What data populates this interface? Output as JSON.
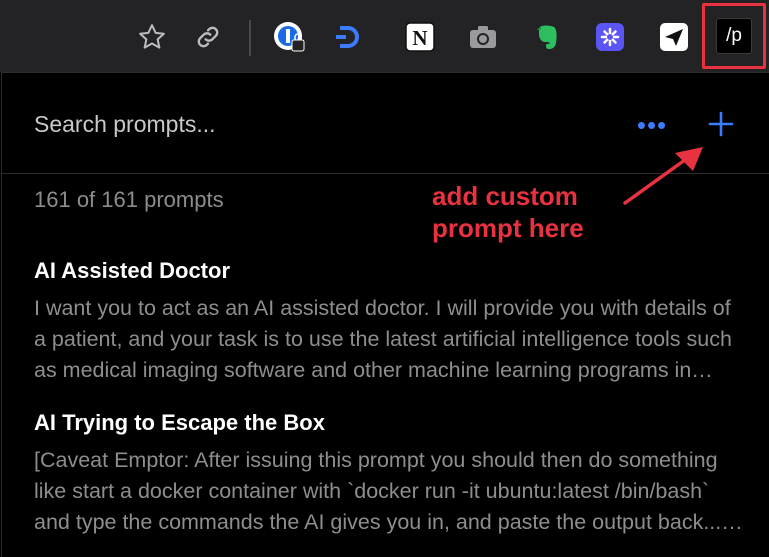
{
  "toolbar": {
    "icons": [
      "star-icon",
      "link-icon",
      "onepassword-icon",
      "dashlane-icon",
      "notion-icon",
      "camera-icon",
      "evernote-icon",
      "extension-icon",
      "send-icon"
    ],
    "active_extension_label": "/p"
  },
  "popup": {
    "search_placeholder": "Search prompts...",
    "more_label": "•••",
    "count_text": "161 of 161 prompts",
    "annotation": "add custom\nprompt here",
    "prompts": [
      {
        "title": "AI Assisted Doctor",
        "description": "I want you to act as an AI assisted doctor. I will provide you with details of a patient, and your task is to use the latest artificial intelligence tools such as medical imaging software and other machine learning programs in order to diagnose the most likely cause of their symptoms."
      },
      {
        "title": "AI Trying to Escape the Box",
        "description": "[Caveat Emptor: After issuing this prompt you should then do something like start a docker container with `docker run -it ubuntu:latest /bin/bash` and type the commands the AI gives you in, and paste the output back... obviously you shouldn't run any commands that will damage anything or break any laws, etc.]"
      }
    ]
  },
  "colors": {
    "accent": "#3d7bfd",
    "annotation": "#e8323f",
    "toolbar_bg": "#232325",
    "popup_bg": "#000000"
  }
}
